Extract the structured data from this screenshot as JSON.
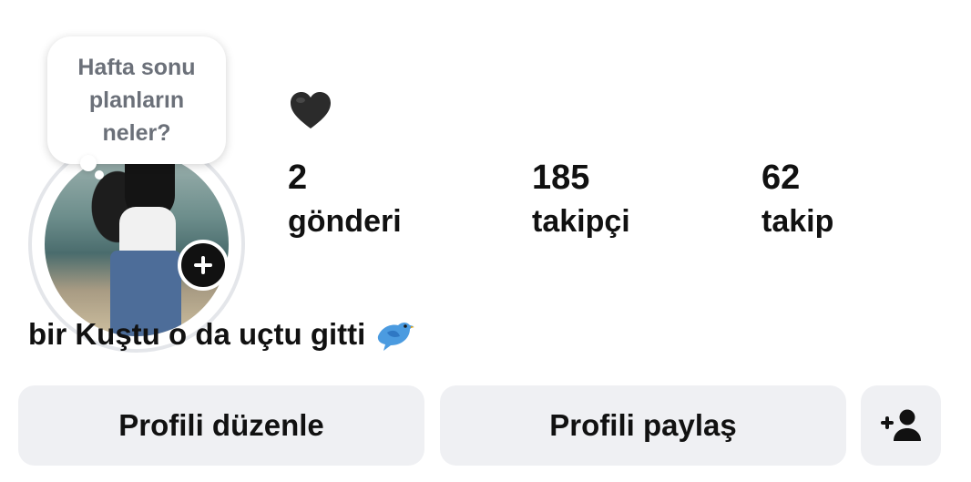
{
  "note": {
    "text": "Hafta sonu planların neler?"
  },
  "name_line": {
    "emoji": "black-heart-emoji"
  },
  "stats": {
    "posts": {
      "count": "2",
      "label": "gönderi"
    },
    "followers": {
      "count": "185",
      "label": "takipçi"
    },
    "following": {
      "count": "62",
      "label": "takip"
    }
  },
  "bio": {
    "text": "bir Kuştu o da uçtu gitti",
    "emoji": "bird-emoji"
  },
  "buttons": {
    "edit_profile": "Profili düzenle",
    "share_profile": "Profili paylaş",
    "add_person_icon": "add-person-icon"
  },
  "colors": {
    "button_bg": "#eff0f3",
    "text": "#111111",
    "note_text": "#6b7079",
    "ring": "#e4e6ea"
  }
}
